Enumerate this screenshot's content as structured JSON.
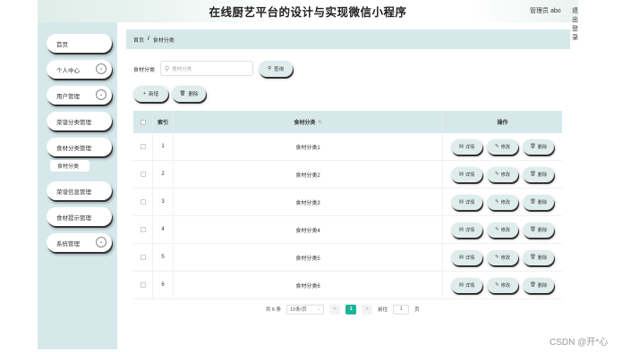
{
  "header": {
    "title": "在线厨艺平台的设计与实现微信小程序",
    "admin": "管理员 abo",
    "logout": "退出登录"
  },
  "sidebar": {
    "items": [
      {
        "label": "首页",
        "has_dropdown": false
      },
      {
        "label": "个人中心",
        "has_dropdown": true
      },
      {
        "label": "用户管理",
        "has_dropdown": true
      },
      {
        "label": "菜谱分类管理",
        "has_dropdown": false
      },
      {
        "label": "食材分类管理",
        "has_dropdown": false
      },
      {
        "label": "菜谱信息管理",
        "has_dropdown": false
      },
      {
        "label": "食材提示管理",
        "has_dropdown": false
      },
      {
        "label": "系统管理",
        "has_dropdown": true
      }
    ],
    "active_sub": "食材分类"
  },
  "breadcrumb": {
    "home": "首页",
    "separator": "/",
    "current": "食材分类"
  },
  "search": {
    "label": "食材分类",
    "placeholder": "食材分类",
    "query_button": "查询"
  },
  "actions": {
    "add": "新增",
    "delete": "删除"
  },
  "table": {
    "columns": {
      "index": "索引",
      "name": "食材分类",
      "ops": "操作"
    },
    "rows": [
      {
        "index": "1",
        "name": "食材分类1"
      },
      {
        "index": "2",
        "name": "食材分类2"
      },
      {
        "index": "3",
        "name": "食材分类3"
      },
      {
        "index": "4",
        "name": "食材分类4"
      },
      {
        "index": "5",
        "name": "食材分类5"
      },
      {
        "index": "6",
        "name": "食材分类6"
      }
    ],
    "row_buttons": {
      "detail": "详情",
      "edit": "修改",
      "delete": "删除"
    }
  },
  "pagination": {
    "total": "共 6 条",
    "page_size": "10条/页",
    "prev": "<",
    "current": "1",
    "next": ">",
    "goto_label": "前往",
    "goto_value": "1",
    "page_unit": "页"
  },
  "watermark": "CSDN @开*心",
  "colors": {
    "sidebar_bg": "#d6e8ea",
    "active_page": "#1ab394",
    "button_bg": "#dfecec"
  }
}
